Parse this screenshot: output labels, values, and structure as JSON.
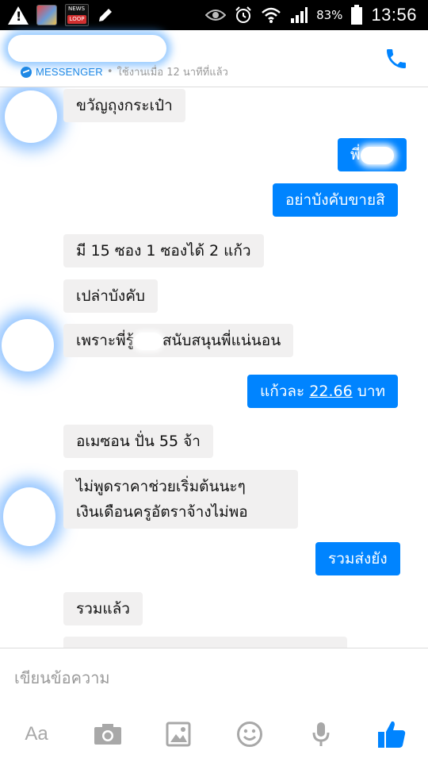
{
  "status_bar": {
    "battery_percent": "83%",
    "time": "13:56",
    "news_badge_top": "NEWS",
    "news_badge_bottom": "LOOP"
  },
  "header": {
    "messenger_label": "MESSENGER",
    "separator": "•",
    "active_text": "ใช้งานเมื่อ 12 นาทีที่แล้ว"
  },
  "messages": [
    {
      "side": "in",
      "text": "ขวัญถุงกระเป๋า"
    },
    {
      "side": "out",
      "text": "พี่"
    },
    {
      "side": "out",
      "text": "อย่าบังคับขายสิ"
    },
    {
      "side": "in",
      "text": "มี 15 ซอง 1 ซองได้ 2 แก้ว"
    },
    {
      "side": "in",
      "text": "เปล่าบังคับ"
    },
    {
      "side": "in",
      "text_before": "เพราะพี่รู้",
      "text_after": "สนับสนุนพี่แน่นอน"
    },
    {
      "side": "out",
      "text_before": "แก้วละ ",
      "amount": "22.66",
      "text_after": " บาท"
    },
    {
      "side": "in",
      "text": "อเมซอน ปั่น 55 จ้า"
    },
    {
      "side": "in",
      "line1": "ไม่พูดราคาช่วยเริ่มต้นนะๆ",
      "line2": "เงินเดือนครูอัตราจ้างไม่พอ"
    },
    {
      "side": "out",
      "text": "รวมส่งยัง"
    },
    {
      "side": "in",
      "text": "รวมแล้ว"
    }
  ],
  "composer": {
    "placeholder": "เขียนข้อความ",
    "aa_label": "Aa"
  },
  "colors": {
    "messenger_blue": "#0084ff",
    "incoming_bubble": "#f1f0f0",
    "icon_gray": "#a8a8a8"
  }
}
